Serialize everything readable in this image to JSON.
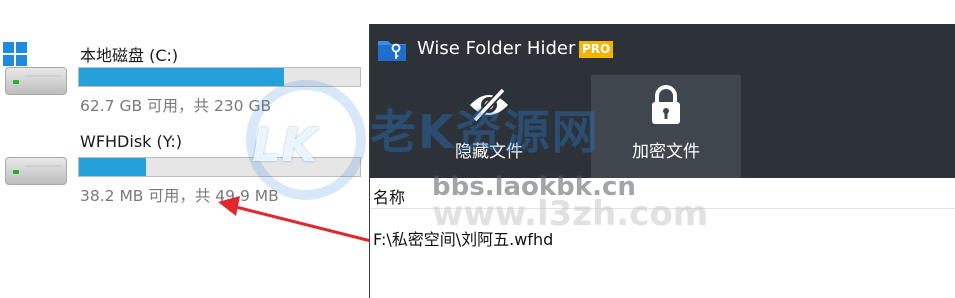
{
  "explorer": {
    "drives": [
      {
        "name": "本地磁盘 (C:)",
        "capacity": "62.7 GB 可用，共 230 GB",
        "used_fraction": 0.73
      },
      {
        "name": "WFHDisk (Y:)",
        "capacity": "38.2 MB 可用，共 49.9 MB",
        "used_fraction": 0.24
      }
    ],
    "bar_color": "#26a0da"
  },
  "app": {
    "title": "Wise Folder Hider",
    "badge": "PRO",
    "toolbar": [
      {
        "label": "隐藏文件",
        "icon": "eye-slash-icon",
        "active": false
      },
      {
        "label": "加密文件",
        "icon": "lock-icon",
        "active": true
      }
    ],
    "list": {
      "column_header": "名称",
      "rows": [
        "F:\\私密空间\\刘阿五.wfhd"
      ]
    },
    "colors": {
      "titlebar": "#2d3239",
      "active_tool": "#40464e",
      "badge": "#f5b400"
    }
  },
  "watermark": {
    "brand": "老K资源网",
    "domain1": "bbs.laokbk.cn",
    "domain2": "www.l3zh.com",
    "logo_text": "LK"
  }
}
